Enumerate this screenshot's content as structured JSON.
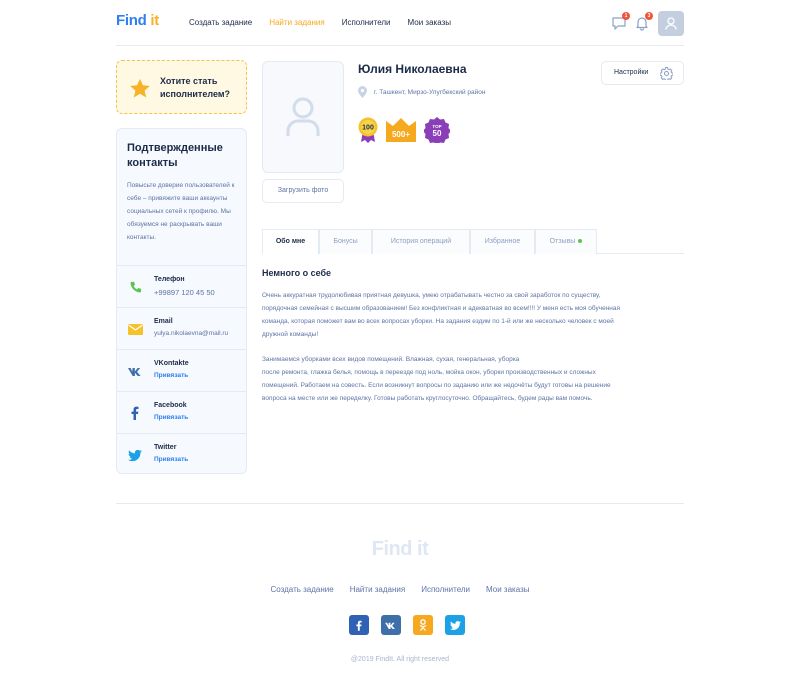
{
  "header": {
    "logo_find": "Find",
    "logo_it": "it",
    "nav": [
      "Создать задание",
      "Найти задания",
      "Исполнители",
      "Мои заказы"
    ],
    "active_nav": "Найти задания",
    "messages_badge": "1",
    "notifications_badge": "3"
  },
  "become": {
    "line1": "Хотите стать",
    "line2": "исполнителем?"
  },
  "contacts": {
    "title_line1": "Подтвержденные",
    "title_line2": "контакты",
    "desc": "Повысьте доверие пользователей к себе – привяжите ваши аккаунты социальных сетей к профилю. Мы обязуемся не раскрывать ваши контакты.",
    "items": [
      {
        "label": "Телефон",
        "value": "+99897 120 45 50",
        "icon": "phone-icon"
      },
      {
        "label": "Email",
        "value": "yulya.nikolaevna@mail.ru",
        "icon": "email-icon"
      },
      {
        "label": "VKontakte",
        "value": "Привязать",
        "icon": "vk-icon"
      },
      {
        "label": "Facebook",
        "value": "Привязать",
        "icon": "facebook-icon"
      },
      {
        "label": "Twitter",
        "value": "Привязать",
        "icon": "twitter-icon"
      }
    ]
  },
  "profile": {
    "name": "Юлия Николаевна",
    "location": "г. Ташкент, Мирзо-Улугбекский район",
    "upload_label": "Загрузить фото",
    "settings_label": "Настройки",
    "badges": [
      {
        "text": "100",
        "color": "#f6c22a"
      },
      {
        "text": "500+",
        "color": "#f6a81f"
      },
      {
        "text": "50",
        "top_text": "TOP",
        "color": "#8a3fb8"
      }
    ]
  },
  "tabs": [
    "Обо мне",
    "Бонусы",
    "История операций",
    "Избранное",
    "Отзывы"
  ],
  "about": {
    "heading": "Немного о себе",
    "p1_lines": [
      "Очень аккуратная трудолюбивая  приятная девушка, умею отрабатывать честно за свой заработок по существу,",
      "порядочная семейная с высшим образованием! Без конфликтная и адекватная во всем!!!! У меня есть моя обученная",
      "команда, которая поможет вам во всех вопросах уборки. На задания ездим по 1-й или же несколько человек с моей",
      "дружной команды!"
    ],
    "p2_lines": [
      "Занимаемся уборками всех видов помещений. Влажная, сухая, генеральная, уборка",
      "после ремонта,  глажка белья, помощь в переезде под ноль, мойка окон, уборки производственных и сложных",
      "помещений. Работаем на совесть. Если возникнут вопросы по заданию или же недочёты будут готовы на решение",
      "вопроса на месте или же переделку. Готовы работать круглосуточно. Обращайтесь, будем рады вам помочь."
    ]
  },
  "footer": {
    "logo": "Find it",
    "nav": [
      "Создать задание",
      "Найти задания",
      "Исполнители",
      "Мои заказы"
    ],
    "social": [
      {
        "name": "facebook",
        "glyph": "f",
        "color": "#2f62b5"
      },
      {
        "name": "vk",
        "glyph": "vk",
        "color": "#3f6fa8"
      },
      {
        "name": "odnoklassniki",
        "glyph": "ok",
        "color": "#f6a81f"
      },
      {
        "name": "twitter",
        "glyph": "t",
        "color": "#1da1e6"
      }
    ],
    "copyright": "@2019 FindIt. All right reserved"
  }
}
